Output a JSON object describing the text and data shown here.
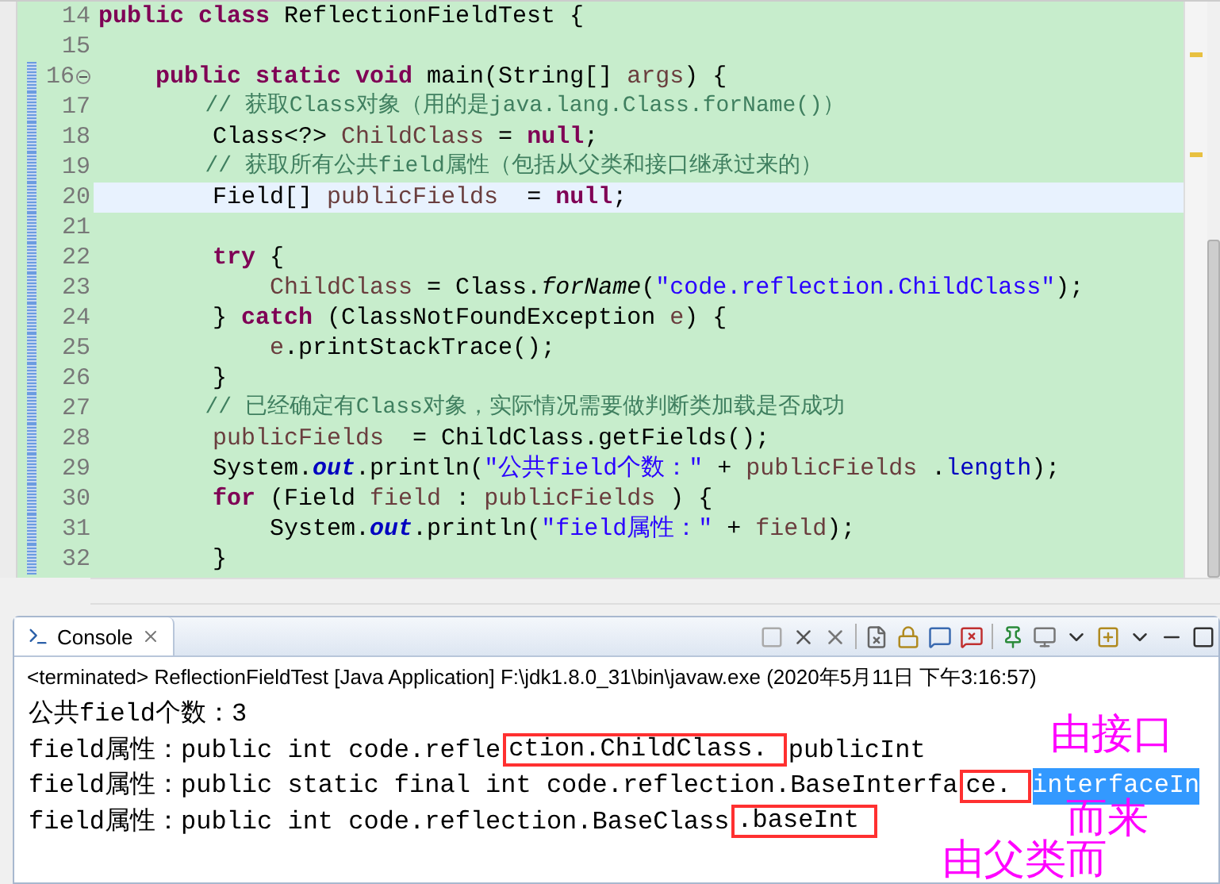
{
  "editor": {
    "lines": [
      {
        "number": "14",
        "highlighted": false,
        "foldable": false,
        "tokens": [
          {
            "text": "public",
            "kind": "kw"
          },
          {
            "text": " class",
            "kind": "kw"
          },
          {
            "text": " ReflectionFieldTest {",
            "kind": "plain"
          }
        ]
      },
      {
        "number": "15",
        "highlighted": false,
        "foldable": false
      },
      {
        "number": "16",
        "highlighted": false,
        "foldable": true,
        "tokens": [
          {
            "text": "    public",
            "kind": "kw"
          },
          {
            "text": " static",
            "kind": "kw"
          },
          {
            "text": " void",
            "kind": "kw"
          },
          {
            "text": " main(String[] ",
            "kind": "plain"
          },
          {
            "text": "args",
            "kind": "var"
          },
          {
            "text": ") {",
            "kind": "plain"
          }
        ]
      },
      {
        "number": "17",
        "highlighted": false,
        "foldable": false,
        "tokens": [
          {
            "text": "        // 获取Class对象（用的是java.lang.Class.forName()）",
            "kind": "cmt"
          }
        ]
      },
      {
        "number": "18",
        "highlighted": false,
        "foldable": false,
        "tokens": [
          {
            "text": "        Class<?> ",
            "kind": "plain"
          },
          {
            "text": "ChildClass",
            "kind": "var"
          },
          {
            "text": " = ",
            "kind": "plain"
          },
          {
            "text": "null",
            "kind": "kw"
          },
          {
            "text": ";",
            "kind": "plain"
          }
        ]
      },
      {
        "number": "19",
        "highlighted": false,
        "foldable": false,
        "tokens": [
          {
            "text": "        // 获取所有公共field属性（包括从父类和接口继承过来的）",
            "kind": "cmt"
          }
        ]
      },
      {
        "number": "20",
        "highlighted": true,
        "foldable": false,
        "tokens": [
          {
            "text": "        Field[] ",
            "kind": "plain"
          },
          {
            "text": "publicFields",
            "kind": "var"
          },
          {
            "text": "  = ",
            "kind": "plain"
          },
          {
            "text": "null",
            "kind": "kw"
          },
          {
            "text": ";",
            "kind": "plain"
          }
        ]
      },
      {
        "number": "21",
        "highlighted": false,
        "foldable": false
      },
      {
        "number": "22",
        "highlighted": false,
        "foldable": false,
        "tokens": [
          {
            "text": "        try",
            "kind": "kw"
          },
          {
            "text": " {",
            "kind": "plain"
          }
        ]
      },
      {
        "number": "23",
        "highlighted": false,
        "foldable": false,
        "tokens": [
          {
            "text": "            ChildClass",
            "kind": "var"
          },
          {
            "text": " = Class.",
            "kind": "plain"
          },
          {
            "text": "forName",
            "kind": "italic"
          },
          {
            "text": "(",
            "kind": "plain"
          },
          {
            "text": "\"code.reflection.ChildClass\"",
            "kind": "str"
          },
          {
            "text": ");",
            "kind": "plain"
          }
        ]
      },
      {
        "number": "24",
        "highlighted": false,
        "foldable": false,
        "tokens": [
          {
            "text": "        } ",
            "kind": "plain"
          },
          {
            "text": "catch",
            "kind": "kw"
          },
          {
            "text": " (ClassNotFoundException ",
            "kind": "plain"
          },
          {
            "text": "e",
            "kind": "var"
          },
          {
            "text": ") {",
            "kind": "plain"
          }
        ]
      },
      {
        "number": "25",
        "highlighted": false,
        "foldable": false,
        "tokens": [
          {
            "text": "            e",
            "kind": "var"
          },
          {
            "text": ".printStackTrace();",
            "kind": "plain"
          }
        ]
      },
      {
        "number": "26",
        "highlighted": false,
        "foldable": false,
        "tokens": [
          {
            "text": "        }",
            "kind": "plain"
          }
        ]
      },
      {
        "number": "27",
        "highlighted": false,
        "foldable": false,
        "tokens": [
          {
            "text": "        // 已经确定有Class对象，实际情况需要做判断类加载是否成功",
            "kind": "cmt"
          }
        ]
      },
      {
        "number": "28",
        "highlighted": false,
        "foldable": false,
        "tokens": [
          {
            "text": "        publicFields",
            "kind": "var"
          },
          {
            "text": "  = ChildClass.getFields();",
            "kind": "plain"
          }
        ]
      },
      {
        "number": "29",
        "highlighted": false,
        "foldable": false,
        "tokens": [
          {
            "text": "        System.",
            "kind": "plain"
          },
          {
            "text": "out",
            "kind": "static"
          },
          {
            "text": ".println(",
            "kind": "plain"
          },
          {
            "text": "\"公共field个数：\"",
            "kind": "str"
          },
          {
            "text": " + ",
            "kind": "plain"
          },
          {
            "text": "publicFields",
            "kind": "var"
          },
          {
            "text": " .",
            "kind": "plain"
          },
          {
            "text": "length",
            "kind": "field"
          },
          {
            "text": ");",
            "kind": "plain"
          }
        ]
      },
      {
        "number": "30",
        "highlighted": false,
        "foldable": false,
        "tokens": [
          {
            "text": "        for",
            "kind": "kw"
          },
          {
            "text": " (Field ",
            "kind": "plain"
          },
          {
            "text": "field",
            "kind": "var"
          },
          {
            "text": " : ",
            "kind": "plain"
          },
          {
            "text": "publicFields",
            "kind": "var"
          },
          {
            "text": " ) {",
            "kind": "plain"
          }
        ]
      },
      {
        "number": "31",
        "highlighted": false,
        "foldable": false,
        "tokens": [
          {
            "text": "            System.",
            "kind": "plain"
          },
          {
            "text": "out",
            "kind": "static"
          },
          {
            "text": ".println(",
            "kind": "plain"
          },
          {
            "text": "\"field属性：\"",
            "kind": "str"
          },
          {
            "text": " + ",
            "kind": "plain"
          },
          {
            "text": "field",
            "kind": "var"
          },
          {
            "text": ");",
            "kind": "plain"
          }
        ]
      },
      {
        "number": "32",
        "highlighted": false,
        "foldable": false,
        "tokens": [
          {
            "text": "        }",
            "kind": "plain"
          }
        ]
      }
    ]
  },
  "console": {
    "title": "Console",
    "status": "<terminated> ReflectionFieldTest [Java Application] F:\\jdk1.8.0_31\\bin\\javaw.exe (2020年5月11日 下午3:16:57)",
    "output": [
      {
        "segments": [
          {
            "text": "公共field个数：3",
            "selected": false,
            "boxed": false
          }
        ]
      },
      {
        "segments": [
          {
            "text": "field属性：public int code.refle",
            "selected": false,
            "boxed": false
          },
          {
            "text": "ction.ChildClass.",
            "selected": false,
            "boxed": true
          },
          {
            "text": "publicInt",
            "selected": false,
            "boxed": false
          }
        ]
      },
      {
        "segments": [
          {
            "text": "field属性：public static final int code.reflection.BaseInterfa",
            "selected": false,
            "boxed": false
          },
          {
            "text": "ce.",
            "selected": false,
            "boxed": true
          },
          {
            "text": "interfaceIn",
            "selected": true,
            "boxed": false
          }
        ]
      },
      {
        "segments": [
          {
            "text": "field属性：public int code.reflection.BaseClass",
            "selected": false,
            "boxed": false
          },
          {
            "text": ".baseInt",
            "selected": false,
            "boxed": true
          }
        ]
      }
    ]
  },
  "annotations": [
    "由接口",
    "而来",
    "由父类而"
  ]
}
